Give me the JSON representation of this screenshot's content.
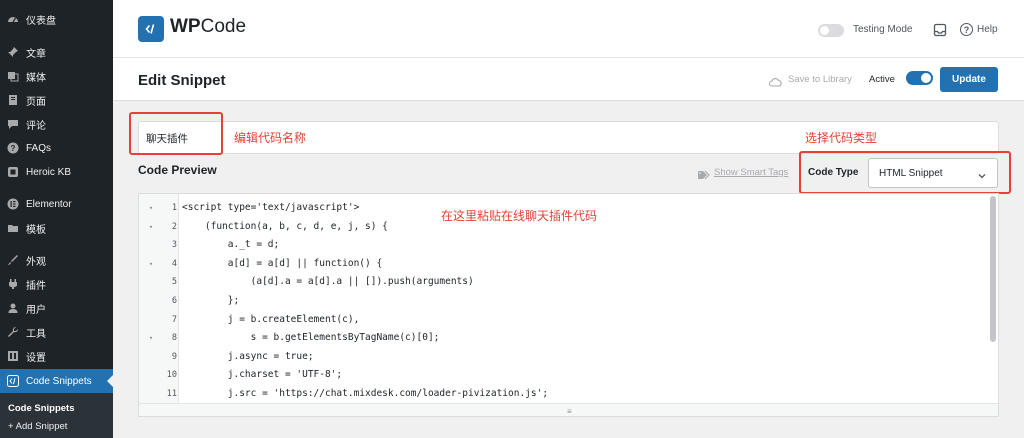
{
  "sidebar": {
    "items": [
      {
        "label": "仪表盘",
        "icon": "dashboard-icon"
      },
      {
        "label": "文章",
        "icon": "pin-icon"
      },
      {
        "label": "媒体",
        "icon": "media-icon"
      },
      {
        "label": "页面",
        "icon": "page-icon"
      },
      {
        "label": "评论",
        "icon": "comment-icon"
      },
      {
        "label": "FAQs",
        "icon": "question-icon"
      },
      {
        "label": "Heroic KB",
        "icon": "book-icon"
      },
      {
        "label": "Elementor",
        "icon": "elementor-icon"
      },
      {
        "label": "模板",
        "icon": "folder-icon"
      },
      {
        "label": "外观",
        "icon": "brush-icon"
      },
      {
        "label": "插件",
        "icon": "plugin-icon"
      },
      {
        "label": "用户",
        "icon": "user-icon"
      },
      {
        "label": "工具",
        "icon": "wrench-icon"
      },
      {
        "label": "设置",
        "icon": "settings-icon"
      },
      {
        "label": "Code Snippets",
        "icon": "code-snippets-icon"
      }
    ],
    "submenu": [
      {
        "label": "Code Snippets"
      },
      {
        "label": "+ Add Snippet"
      }
    ]
  },
  "header": {
    "logo_bold": "WP",
    "logo_rest": "Code",
    "testing_mode_label": "Testing Mode",
    "help_label": "Help"
  },
  "titlebar": {
    "page_title": "Edit Snippet",
    "save_to_library": "Save to Library",
    "active_label": "Active",
    "update_button": "Update"
  },
  "snippet": {
    "title_value": "聊天插件",
    "code_preview_heading": "Code Preview",
    "show_smart_tags": "Show Smart Tags",
    "code_type_label": "Code Type",
    "code_type_value": "HTML Snippet"
  },
  "annotations": {
    "edit_name": "编辑代码名称",
    "choose_type": "选择代码类型",
    "paste_code": "在这里粘贴在线聊天插件代码"
  },
  "code": {
    "lines": [
      {
        "num": "1",
        "fold": "▾",
        "text": "<script type='text/javascript'>"
      },
      {
        "num": "2",
        "fold": "▾",
        "text": "    (function(a, b, c, d, e, j, s) {"
      },
      {
        "num": "3",
        "fold": "",
        "text": "        a._t = d;"
      },
      {
        "num": "4",
        "fold": "▾",
        "text": "        a[d] = a[d] || function() {"
      },
      {
        "num": "5",
        "fold": "",
        "text": "            (a[d].a = a[d].a || []).push(arguments)"
      },
      {
        "num": "6",
        "fold": "",
        "text": "        };"
      },
      {
        "num": "7",
        "fold": "",
        "text": "        j = b.createElement(c),"
      },
      {
        "num": "8",
        "fold": "▾",
        "text": "            s = b.getElementsByTagName(c)[0];"
      },
      {
        "num": "9",
        "fold": "",
        "text": "        j.async = true;"
      },
      {
        "num": "10",
        "fold": "",
        "text": "        j.charset = 'UTF-8';"
      },
      {
        "num": "11",
        "fold": "",
        "text": "        j.src = 'https://chat.mixdesk.com/loader-pivization.js';"
      }
    ]
  },
  "colors": {
    "accent": "#2271b1",
    "sidebar_bg": "#1d2327",
    "annotation": "#e34234"
  }
}
